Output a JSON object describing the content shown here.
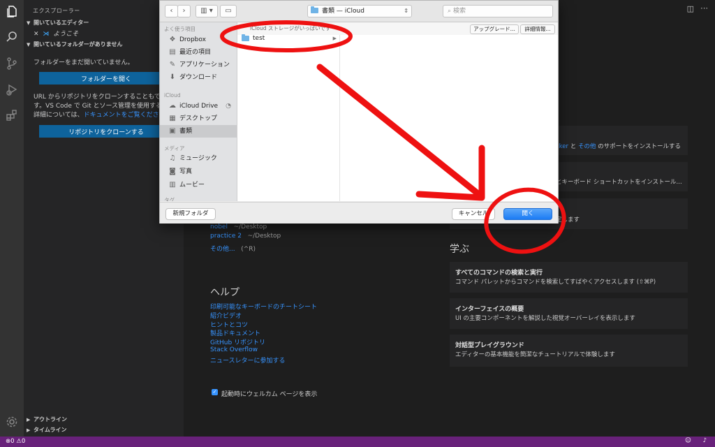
{
  "sidebar": {
    "title": "エクスプローラー",
    "open_editors": "開いているエディター",
    "welcome_tab": "ようこそ",
    "no_folder_header": "開いているフォルダーがありません",
    "no_folder_text": "フォルダーをまだ開いていません。",
    "open_folder_button": "フォルダーを開く",
    "clone_text_1": "URL からリポジトリをクローンすることもでき",
    "clone_text_2": "す。VS Code で Git とソース管理を使用する方",
    "clone_text_3": "詳細については、",
    "docs_link": "ドキュメントをご覧くださ",
    "clone_button": "リポジトリをクローンする",
    "outline": "アウトライン",
    "timeline": "タイムライン"
  },
  "welcome": {
    "recent": [
      {
        "name": "nobel",
        "path": "~/Desktop"
      },
      {
        "name": "practice 2",
        "path": "~/Desktop"
      }
    ],
    "more": "その他...",
    "more_shortcut": "(^R)",
    "help_heading": "ヘルプ",
    "help_links": [
      "印刷可能なキーボードのチートシート",
      "紹介ビデオ",
      "ヒントとコツ",
      "製品ドキュメント",
      "GitHub リポジトリ",
      "Stack Overflow",
      "ニュースレターに参加する"
    ],
    "show_on_startup": "起動時にウェルカム ページを表示",
    "card1_fragment": "cker",
    "card1_and": "と",
    "card1_other": "その他",
    "card1_desc": "のサポートをインストールする",
    "card2_desc": "とキーボード ショートカットをインストール...",
    "card3_desc": "定します",
    "learn_heading": "学ぶ",
    "learn_cards": [
      {
        "title": "すべてのコマンドの検索と実行",
        "desc": "コマンド パレットからコマンドを検索してすばやくアクセスします (⇧⌘P)"
      },
      {
        "title": "インターフェイスの概要",
        "desc": "UI の主要コンポーネントを解説した視覚オーバーレイを表示します"
      },
      {
        "title": "対話型プレイグラウンド",
        "desc": "エディターの基本機能を簡潔なチュートリアルで体験します"
      }
    ]
  },
  "dialog": {
    "location": "書類 — iCloud",
    "search_placeholder": "検索",
    "favorites_label": "よく使う項目",
    "favorites": [
      "Dropbox",
      "最近の項目",
      "アプリケーション",
      "ダウンロード"
    ],
    "icloud_label": "iCloud",
    "icloud_items": [
      "iCloud Drive",
      "デスクトップ",
      "書類"
    ],
    "media_label": "メディア",
    "media_items": [
      "ミュージック",
      "写真",
      "ムービー"
    ],
    "tags_label": "タグ",
    "banner_text": "iCloud ストレージがいっぱいです",
    "upgrade_button": "アップグレード...",
    "details_button": "詳細情報...",
    "folder_item": "test",
    "new_folder_button": "新規フォルダ",
    "cancel_button": "キャンセル",
    "open_button": "開く"
  },
  "status": {
    "errors": "0",
    "warnings": "0"
  },
  "colors": {
    "annotation": "#ee1111",
    "status_bar": "#68217a",
    "accent": "#0e639c"
  }
}
